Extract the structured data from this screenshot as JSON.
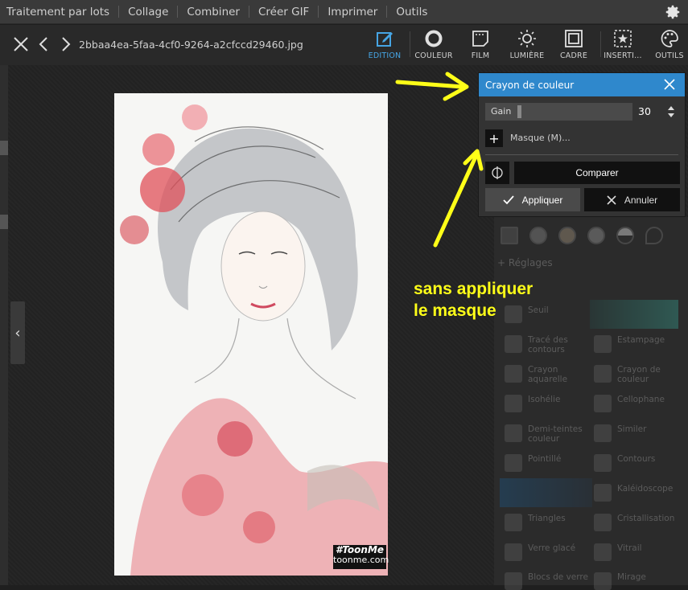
{
  "menubar": {
    "items": [
      "Traitement par lots",
      "Collage",
      "Combiner",
      "Créer GIF",
      "Imprimer",
      "Outils"
    ],
    "settings_icon": "gear-icon"
  },
  "toolbar": {
    "filename": "2bbaa4ea-5faa-4cf0-9264-a2cfccd29460.jpg",
    "tools": [
      {
        "label": "EDITION",
        "icon": "edit-icon",
        "active": true
      },
      {
        "label": "COULEUR",
        "icon": "color-ring-icon"
      },
      {
        "label": "FILM",
        "icon": "film-icon"
      },
      {
        "label": "LUMIÈRE",
        "icon": "sun-icon"
      },
      {
        "label": "CADRE",
        "icon": "frame-icon"
      },
      {
        "label": "INSERTI...",
        "icon": "insert-star-icon"
      },
      {
        "label": "OUTILS",
        "icon": "palette-icon"
      }
    ]
  },
  "image": {
    "watermark_brand": "#ToonMe",
    "watermark_site": "toonme.com"
  },
  "dialog": {
    "title": "Crayon de couleur",
    "gain_label": "Gain",
    "gain_value": "30",
    "mask_label": "Masque (M)...",
    "compare_label": "Comparer",
    "apply_label": "Appliquer",
    "cancel_label": "Annuler"
  },
  "right_panel": {
    "section_label": "Réglages",
    "effects": [
      "Seuil",
      "Tracé des contours",
      "Estampage",
      "Crayon aquarelle",
      "Crayon de couleur",
      "Isohélie",
      "Cellophane",
      "Demi-teintes couleur",
      "Similer",
      "Pointillé",
      "Contours",
      "Kaléidoscope",
      "Triangles",
      "Cristallisation",
      "Verre glacé",
      "Vitrail",
      "Blocs de verre",
      "Mirage"
    ]
  },
  "annotation": {
    "line1": "sans appliquer",
    "line2": "le masque",
    "color": "#ffff18"
  },
  "colors": {
    "accent": "#2f88cc",
    "active_tool": "#46a5e4"
  }
}
